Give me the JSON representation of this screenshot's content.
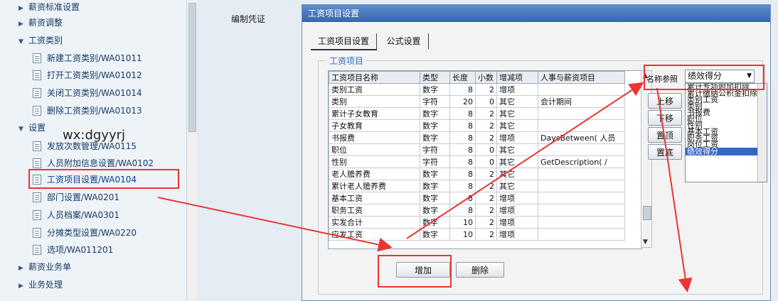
{
  "sidebar": {
    "items": [
      {
        "label": "薪资标准设置",
        "type": "folder"
      },
      {
        "label": "薪资调整",
        "type": "folder"
      },
      {
        "label": "工资类别",
        "type": "folder-open"
      },
      {
        "label": "新建工资类别/WA01011",
        "type": "leaf"
      },
      {
        "label": "打开工资类别/WA01012",
        "type": "leaf"
      },
      {
        "label": "关闭工资类别/WA01014",
        "type": "leaf"
      },
      {
        "label": "删除工资类别/WA01013",
        "type": "leaf"
      },
      {
        "label": "设置",
        "type": "folder-open"
      },
      {
        "label": "发放次数管理/WA0115",
        "type": "leaf"
      },
      {
        "label": "人员附加信息设置/WA0102",
        "type": "leaf"
      },
      {
        "label": "工资项目设置/WA0104",
        "type": "leaf-selected"
      },
      {
        "label": "部门设置/WA0201",
        "type": "leaf"
      },
      {
        "label": "人员档案/WA0301",
        "type": "leaf"
      },
      {
        "label": "分摊类型设置/WA0220",
        "type": "leaf"
      },
      {
        "label": "选项/WA011201",
        "type": "leaf"
      },
      {
        "label": "薪资业务单",
        "type": "folder"
      },
      {
        "label": "业务处理",
        "type": "folder"
      }
    ]
  },
  "watermark": "wx:dgyyrj",
  "middle": {
    "label": "编制凭证"
  },
  "dialog": {
    "title": "工资项目设置",
    "tabs": [
      "工资项目设置",
      "公式设置"
    ],
    "group_title": "工资项目",
    "columns": [
      "工资项目名称",
      "类型",
      "长度",
      "小数",
      "增减项",
      "人事与薪资项目"
    ],
    "rows": [
      [
        "类别工资",
        "数字",
        "8",
        "2",
        "增项",
        ""
      ],
      [
        "类别",
        "字符",
        "20",
        "0",
        "其它",
        "会计期间"
      ],
      [
        "累计子女教育",
        "数字",
        "8",
        "2",
        "其它",
        ""
      ],
      [
        "子女教育",
        "数字",
        "8",
        "2",
        "其它",
        ""
      ],
      [
        "书报费",
        "数字",
        "8",
        "2",
        "增项",
        "DaysBetween( 人员"
      ],
      [
        "职位",
        "字符",
        "8",
        "0",
        "其它",
        ""
      ],
      [
        "性别",
        "字符",
        "8",
        "0",
        "其它",
        "GetDescription( /"
      ],
      [
        "老人赡养费",
        "数字",
        "8",
        "2",
        "其它",
        ""
      ],
      [
        "累计老人赡养费",
        "数字",
        "8",
        "2",
        "其它",
        ""
      ],
      [
        "基本工资",
        "数字",
        "8",
        "2",
        "增项",
        ""
      ],
      [
        "职务工资",
        "数字",
        "8",
        "2",
        "增项",
        ""
      ],
      [
        "实发合计",
        "数字",
        "10",
        "2",
        "增项",
        ""
      ],
      [
        "应发工资",
        "数字",
        "10",
        "2",
        "增项",
        ""
      ]
    ],
    "side_buttons": [
      "上移",
      "下移",
      "置顶",
      "置底"
    ],
    "add_label": "增加",
    "delete_label": "删除",
    "ref_label": "名称参照",
    "ref_value": "绩效得分",
    "ref_options": [
      "累计专项附加扣除",
      "累计缴纳公积金扣除",
      "类别工资",
      "类别",
      "书报费",
      "职位",
      "性别",
      "基本工资",
      "职务工资",
      "岗位工资",
      "绩效得分"
    ],
    "ref_selected": "绩效得分"
  },
  "colors": {
    "highlight": "#ee3333",
    "titlebar": "#3767ad",
    "selection": "#3367c8"
  }
}
